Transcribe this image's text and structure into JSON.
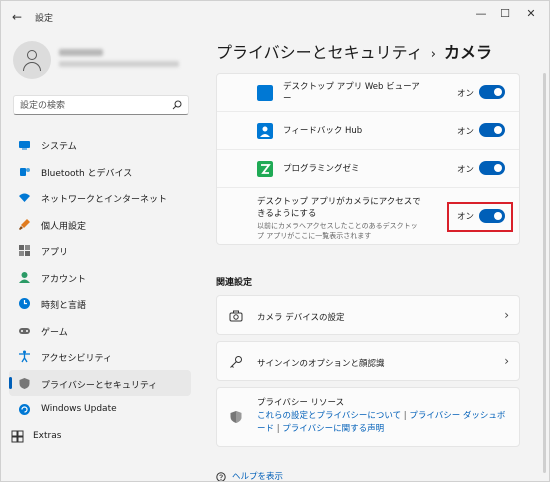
{
  "window": {
    "title": "設定",
    "controls": {
      "minimize": "—",
      "maximize": "☐",
      "close": "✕"
    }
  },
  "search": {
    "placeholder": "設定の検索"
  },
  "sidebar": {
    "items": [
      {
        "label": "システム",
        "icon": "system-icon",
        "color": "#0078d4"
      },
      {
        "label": "Bluetooth とデバイス",
        "icon": "bluetooth-icon",
        "color": "#0078d4"
      },
      {
        "label": "ネットワークとインターネット",
        "icon": "wifi-icon",
        "color": "#0078d4"
      },
      {
        "label": "個人用設定",
        "icon": "brush-icon",
        "color": "#e07b1f"
      },
      {
        "label": "アプリ",
        "icon": "apps-icon",
        "color": "#555555"
      },
      {
        "label": "アカウント",
        "icon": "account-icon",
        "color": "#2b9a66"
      },
      {
        "label": "時刻と言語",
        "icon": "globe-clock-icon",
        "color": "#0078d4"
      },
      {
        "label": "ゲーム",
        "icon": "gamepad-icon",
        "color": "#555555"
      },
      {
        "label": "アクセシビリティ",
        "icon": "accessibility-icon",
        "color": "#0078d4"
      },
      {
        "label": "プライバシーとセキュリティ",
        "icon": "shield-icon",
        "color": "#555555",
        "active": true
      },
      {
        "label": "Windows Update",
        "icon": "update-icon",
        "color": "#0078d4"
      },
      {
        "label": "Extras",
        "icon": "extras-icon",
        "color": "#333333"
      }
    ]
  },
  "header": {
    "parent": "プライバシーとセキュリティ",
    "separator": "›",
    "current": "カメラ"
  },
  "apps": [
    {
      "name": "デスクトップ アプリ Web ビューアー",
      "state": "オン",
      "icon": "desktop-app-icon",
      "color": "#0078d4",
      "on": true
    },
    {
      "name": "フィードバック Hub",
      "state": "オン",
      "icon": "feedback-hub-icon",
      "color": "#0078d4",
      "on": true
    },
    {
      "name": "プログラミングゼミ",
      "state": "オン",
      "icon": "programming-zemi-icon",
      "color": "#1faa55",
      "on": true
    }
  ],
  "desktop_access": {
    "title": "デスクトップ アプリがカメラにアクセスできるようにする",
    "subtitle": "以前にカメラへアクセスしたことのあるデスクトップ アプリがここに一覧表示されます",
    "state": "オン",
    "on": true
  },
  "related": {
    "title": "関連設定",
    "camera_devices": "カメラ デバイスの設定",
    "signin_options": "サインインのオプションと顔認識"
  },
  "privacy_resources": {
    "title": "プライバシー リソース",
    "link1": "これらの設定とプライバシーについて",
    "link2": "プライバシー ダッシュボード",
    "link3": "プライバシーに関する声明",
    "separator": "|"
  },
  "help": {
    "label": "ヘルプを表示"
  },
  "colors": {
    "accent": "#005fb8",
    "highlight": "#d9202a"
  }
}
